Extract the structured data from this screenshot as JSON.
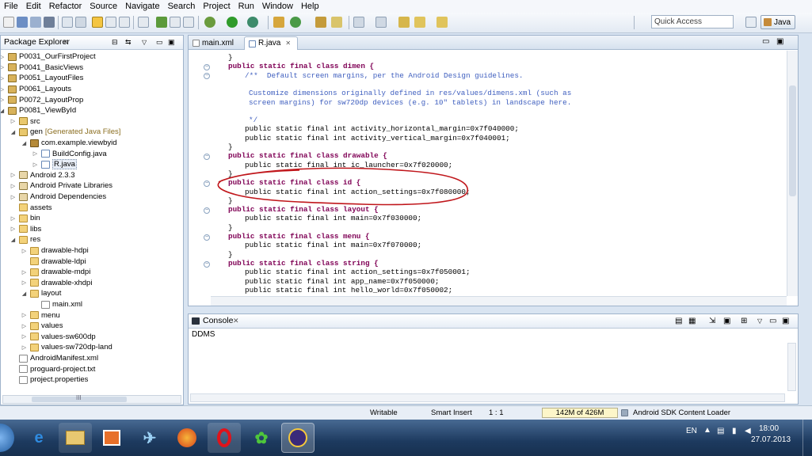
{
  "menu": [
    "File",
    "Edit",
    "Refactor",
    "Source",
    "Navigate",
    "Search",
    "Project",
    "Run",
    "Window",
    "Help"
  ],
  "quick_access": {
    "placeholder": "Quick Access"
  },
  "perspective": {
    "label": "Java"
  },
  "package_explorer": {
    "title": "Package Explorer",
    "items": [
      {
        "label": "P0031_OurFirstProject",
        "suffix": ""
      },
      {
        "label": "P0041_BasicViews",
        "suffix": ""
      },
      {
        "label": "P0051_LayoutFiles",
        "suffix": ""
      },
      {
        "label": "P0061_Layouts",
        "suffix": ""
      },
      {
        "label": "P0072_LayoutProp",
        "suffix": ""
      },
      {
        "label": "P0081_ViewById",
        "suffix": ""
      },
      {
        "label": "src",
        "suffix": ""
      },
      {
        "label": "gen",
        "suffix": "[Generated Java Files]"
      },
      {
        "label": "com.example.viewbyid",
        "suffix": ""
      },
      {
        "label": "BuildConfig.java",
        "suffix": ""
      },
      {
        "label": "R.java",
        "suffix": ""
      },
      {
        "label": "Android 2.3.3",
        "suffix": ""
      },
      {
        "label": "Android Private Libraries",
        "suffix": ""
      },
      {
        "label": "Android Dependencies",
        "suffix": ""
      },
      {
        "label": "assets",
        "suffix": ""
      },
      {
        "label": "bin",
        "suffix": ""
      },
      {
        "label": "libs",
        "suffix": ""
      },
      {
        "label": "res",
        "suffix": ""
      },
      {
        "label": "drawable-hdpi",
        "suffix": ""
      },
      {
        "label": "drawable-ldpi",
        "suffix": ""
      },
      {
        "label": "drawable-mdpi",
        "suffix": ""
      },
      {
        "label": "drawable-xhdpi",
        "suffix": ""
      },
      {
        "label": "layout",
        "suffix": ""
      },
      {
        "label": "main.xml",
        "suffix": ""
      },
      {
        "label": "menu",
        "suffix": ""
      },
      {
        "label": "values",
        "suffix": ""
      },
      {
        "label": "values-sw600dp",
        "suffix": ""
      },
      {
        "label": "values-sw720dp-land",
        "suffix": ""
      },
      {
        "label": "AndroidManifest.xml",
        "suffix": ""
      },
      {
        "label": "proguard-project.txt",
        "suffix": ""
      },
      {
        "label": "project.properties",
        "suffix": ""
      }
    ],
    "scroll_label": "III"
  },
  "editor": {
    "tabs": [
      {
        "label": "main.xml"
      },
      {
        "label": "R.java"
      }
    ],
    "lines": [
      "}",
      "public static final class dimen {",
      "/**  Default screen margins, per the Android Design guidelines.",
      "",
      "Customize dimensions originally defined in res/values/dimens.xml (such as",
      "screen margins) for sw720dp devices (e.g. 10\" tablets) in landscape here.",
      "",
      "*/",
      "public static final int activity_horizontal_margin=0x7f040000;",
      "public static final int activity_vertical_margin=0x7f040001;",
      "}",
      "public static final class drawable {",
      "public static final int ic_launcher=0x7f020000;",
      "}",
      "public static final class id {",
      "public static final int action_settings=0x7f080000;",
      "}",
      "public static final class layout {",
      "public static final int main=0x7f030000;",
      "}",
      "public static final class menu {",
      "public static final int main=0x7f070000;",
      "}",
      "public static final class string {",
      "public static final int action_settings=0x7f050001;",
      "public static final int app_name=0x7f050000;",
      "public static final int hello_world=0x7f050002;"
    ]
  },
  "console": {
    "title": "Console",
    "text": "DDMS"
  },
  "status": {
    "writable": "Writable",
    "insert": "Smart Insert",
    "position": "1 : 1",
    "memory": "142M of 426M",
    "loader": "Android SDK Content Loader"
  },
  "taskbar": {
    "lang": "EN",
    "time": "18:00",
    "date": "27.07.2013"
  },
  "colors": {
    "keyword": "#7f0055",
    "comment": "#3f5fbf",
    "field": "#0000c0",
    "annotation": "#c0161b"
  }
}
